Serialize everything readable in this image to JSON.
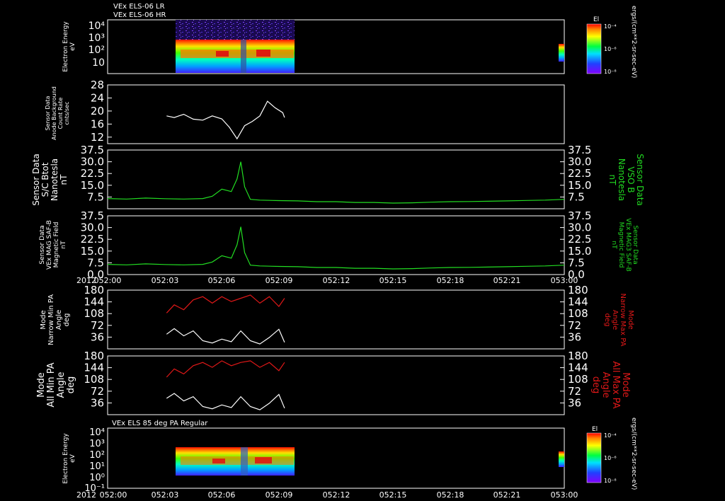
{
  "header": {
    "line1": "VEx ELS-06 LR",
    "line2": "VEx ELS-06 HR"
  },
  "time_axis": {
    "ticks": [
      "052:00",
      "052:03",
      "052:06",
      "052:09",
      "052:12",
      "052:15",
      "052:18",
      "052:21",
      "053:00"
    ],
    "year": "2012"
  },
  "colors": {
    "white": "#ffffff",
    "green": "#22dd22",
    "red": "#e01818",
    "background": "#000000"
  },
  "chart_data": [
    {
      "type": "heatmap",
      "ylabel": [
        "Electron Energy",
        "eV"
      ],
      "yscale": "log",
      "ylim": [
        1,
        20000
      ],
      "ytick_labels": [
        "10⁴",
        "10³",
        "10²",
        "10"
      ],
      "colorbar": {
        "label": "El",
        "ticks": [
          "10⁻⁴",
          "10⁻⁶",
          "10⁻⁸"
        ]
      },
      "colorbar_units": "ergs/(cm**2-sr-sec-eV)",
      "data_time_range": [
        "052:03",
        "052:09:20"
      ]
    },
    {
      "type": "line",
      "ylabel": [
        "Sensor Data",
        "Anode Background",
        "Count Rate",
        "cnts/sec"
      ],
      "ylim": [
        10,
        28
      ],
      "yticks": [
        12,
        16,
        20,
        24,
        28
      ],
      "series": [
        {
          "color": "white",
          "x_min": [
            3.1,
            3.5,
            4.0,
            4.5,
            5.0,
            5.5,
            6.0,
            6.4,
            6.8,
            7.2,
            7.6,
            8.0,
            8.4,
            8.8,
            9.2,
            9.3
          ],
          "y": [
            18.5,
            18.0,
            19.0,
            17.5,
            17.2,
            18.5,
            17.6,
            15.0,
            11.5,
            15.5,
            16.8,
            18.5,
            23.0,
            21.0,
            19.5,
            18.0
          ]
        }
      ]
    },
    {
      "type": "line",
      "ylabel": [
        "Sensor Data",
        "S/C Btot",
        "Nanotesla",
        "nT"
      ],
      "ylabel_right": [
        "Sensor Data",
        "VSO B",
        "Nanotesla",
        "nT"
      ],
      "ylim": [
        0,
        37.5
      ],
      "ytick_labels": [
        "37.5",
        "30.0",
        "22.5",
        "15.0",
        "7.5"
      ],
      "series": [
        {
          "color": "green",
          "x_min": [
            0,
            1,
            2,
            3,
            4,
            5,
            5.5,
            6.0,
            6.5,
            6.8,
            7.0,
            7.2,
            7.5,
            8,
            9,
            10,
            11,
            12,
            13,
            14,
            15,
            16,
            17,
            18,
            19,
            20,
            21,
            22,
            23,
            24
          ],
          "y": [
            6.5,
            6.2,
            6.8,
            6.4,
            6.2,
            6.5,
            8.0,
            12.5,
            11.0,
            19.0,
            30.0,
            14.0,
            6.0,
            5.5,
            5.2,
            5.0,
            4.5,
            4.5,
            4.0,
            4.0,
            3.6,
            3.8,
            4.2,
            4.5,
            4.6,
            4.8,
            5.0,
            5.3,
            5.5,
            6.0
          ]
        }
      ]
    },
    {
      "type": "line",
      "ylabel": [
        "Sensor Data",
        "VEx MAG SAF-B",
        "Magnetic Field",
        "nT"
      ],
      "ylabel_right": [
        "Sensor Data",
        "VEx MAG3 SAF-B",
        "Magnetic Field",
        "nT"
      ],
      "ylim": [
        0,
        37.5
      ],
      "ytick_labels": [
        "37.5",
        "30.0",
        "22.5",
        "15.0",
        "7.5",
        "0.0"
      ],
      "series": [
        {
          "color": "green",
          "x_min": [
            0,
            1,
            2,
            3,
            4,
            5,
            5.5,
            6.0,
            6.5,
            6.8,
            7.0,
            7.2,
            7.5,
            8,
            9,
            10,
            11,
            12,
            13,
            14,
            15,
            16,
            17,
            18,
            19,
            20,
            21,
            22,
            23,
            24
          ],
          "y": [
            6.5,
            6.2,
            6.8,
            6.4,
            6.2,
            6.5,
            8.0,
            12.0,
            10.5,
            19.0,
            30.5,
            14.0,
            6.0,
            5.5,
            5.2,
            5.0,
            4.5,
            4.5,
            4.0,
            4.0,
            3.6,
            3.8,
            4.2,
            4.5,
            4.6,
            4.8,
            5.0,
            5.3,
            5.5,
            6.0
          ]
        }
      ]
    },
    {
      "type": "line",
      "ylabel": [
        "Mode",
        "Narrow Min PA",
        "Angle",
        "deg"
      ],
      "ylabel_right": [
        "Mode",
        "Narrow Max PA",
        "Angle",
        "deg"
      ],
      "ylim": [
        0,
        180
      ],
      "yticks": [
        36,
        72,
        108,
        144,
        180
      ],
      "series": [
        {
          "color": "red",
          "x_min": [
            3.1,
            3.5,
            4.0,
            4.5,
            5.0,
            5.5,
            6.0,
            6.5,
            7.0,
            7.5,
            8.0,
            8.5,
            9.0,
            9.3
          ],
          "y": [
            110,
            135,
            120,
            150,
            160,
            140,
            160,
            145,
            155,
            165,
            140,
            160,
            130,
            155
          ]
        },
        {
          "color": "white",
          "x_min": [
            3.1,
            3.5,
            4.0,
            4.5,
            5.0,
            5.5,
            6.0,
            6.5,
            7.0,
            7.5,
            8.0,
            8.5,
            9.0,
            9.3
          ],
          "y": [
            45,
            62,
            40,
            55,
            25,
            18,
            30,
            22,
            55,
            25,
            15,
            35,
            60,
            20
          ]
        }
      ]
    },
    {
      "type": "line",
      "ylabel": [
        "Mode",
        "All Min PA",
        "Angle",
        "deg"
      ],
      "ylabel_right": [
        "Mode",
        "All Max PA",
        "Angle",
        "deg"
      ],
      "ylim": [
        0,
        180
      ],
      "yticks": [
        36,
        72,
        108,
        144,
        180
      ],
      "series": [
        {
          "color": "red",
          "x_min": [
            3.1,
            3.5,
            4.0,
            4.5,
            5.0,
            5.5,
            6.0,
            6.5,
            7.0,
            7.5,
            8.0,
            8.5,
            9.0,
            9.3
          ],
          "y": [
            115,
            140,
            125,
            150,
            160,
            145,
            165,
            150,
            160,
            165,
            145,
            160,
            135,
            160
          ]
        },
        {
          "color": "white",
          "x_min": [
            3.1,
            3.5,
            4.0,
            4.5,
            5.0,
            5.5,
            6.0,
            6.5,
            7.0,
            7.5,
            8.0,
            8.5,
            9.0,
            9.3
          ],
          "y": [
            50,
            65,
            42,
            55,
            25,
            18,
            30,
            22,
            55,
            25,
            15,
            35,
            62,
            20
          ]
        }
      ]
    },
    {
      "type": "heatmap",
      "title": "VEx ELS 85 deg PA Regular",
      "ylabel": [
        "Electron Energy",
        "eV"
      ],
      "yscale": "log",
      "ylim": [
        0.1,
        20000
      ],
      "ytick_labels": [
        "10⁴",
        "10³",
        "10²",
        "10¹",
        "10⁰",
        "10⁻¹"
      ],
      "colorbar": {
        "label": "El",
        "ticks": [
          "10⁻⁴",
          "10⁻⁶",
          "10⁻⁸"
        ]
      },
      "colorbar_units": "ergs/(cm**2-sr-sec-eV)",
      "data_time_range": [
        "052:03",
        "052:09:20"
      ]
    }
  ]
}
